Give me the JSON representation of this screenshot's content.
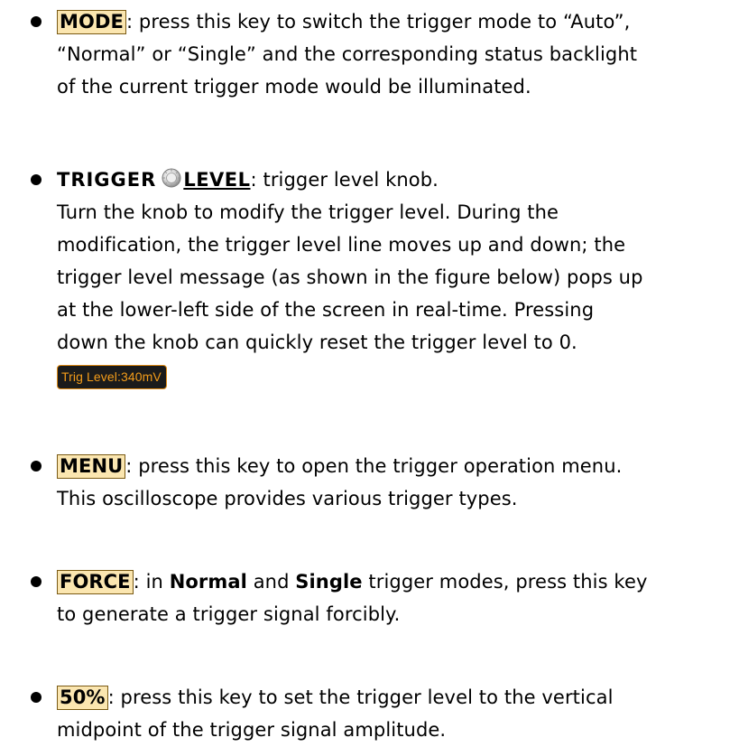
{
  "items": [
    {
      "key": "MODE",
      "lines": [
        ": press this key to switch the trigger mode to “Auto”,",
        "“Normal” or “Single” and the corresponding status backlight",
        "of the current trigger mode would be illuminated."
      ]
    },
    {
      "title_prefix": "TRIGGER",
      "key": "LEVEL",
      "knob_icon": "knob-icon",
      "lines": [
        ": trigger level knob.",
        "Turn the knob to modify the trigger level. During the",
        "modification, the trigger level line moves up and down; the",
        "trigger level message (as shown in the figure below) pops up",
        "at the lower-left side of the screen in real-time. Pressing",
        "down the knob can quickly reset the trigger level to 0."
      ],
      "trigger_message": "Trig Level:340mV"
    },
    {
      "key": "MENU",
      "lines": [
        ": press this key to open the trigger operation menu.",
        "This oscilloscope provides various trigger types."
      ]
    },
    {
      "key": "FORCE",
      "lines": [
        ": in ",
        "Normal",
        " and ",
        "Single",
        " trigger modes, press this key",
        "to generate a trigger signal forcibly."
      ]
    },
    {
      "key": "50%",
      "lines": [
        ": press this key to set the trigger level to the vertical",
        "midpoint of the trigger signal amplitude."
      ]
    }
  ],
  "colors": {
    "key_fill": "#fbe6b0",
    "key_border": "#7a5a14",
    "message_bg": "#1b1b1b",
    "message_text": "#f39c1a"
  }
}
